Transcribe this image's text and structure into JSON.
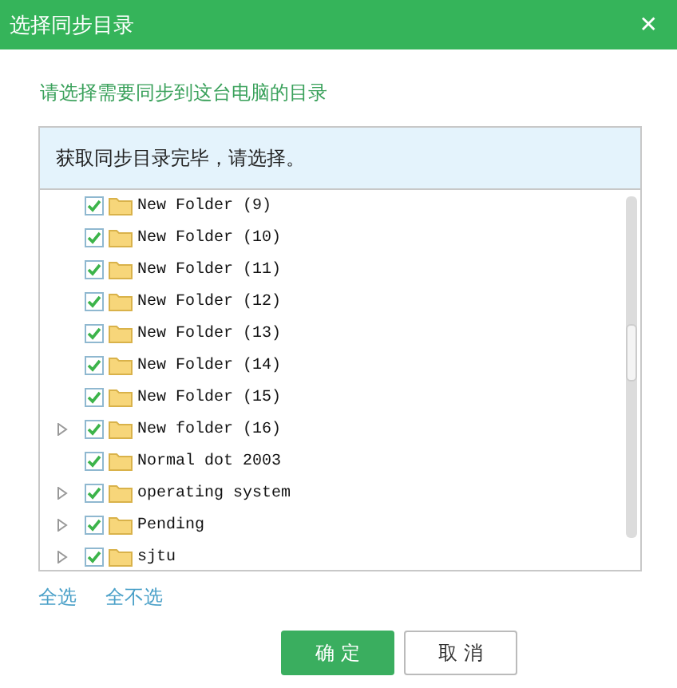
{
  "window": {
    "title": "选择同步目录",
    "close": "✕"
  },
  "instruction": "请选择需要同步到这台电脑的目录",
  "status": "获取同步目录完毕，请选择。",
  "tree": [
    {
      "label": "New Folder (9)",
      "checked": true,
      "expandable": false
    },
    {
      "label": "New Folder (10)",
      "checked": true,
      "expandable": false
    },
    {
      "label": "New Folder (11)",
      "checked": true,
      "expandable": false
    },
    {
      "label": "New Folder (12)",
      "checked": true,
      "expandable": false
    },
    {
      "label": "New Folder (13)",
      "checked": true,
      "expandable": false
    },
    {
      "label": "New Folder (14)",
      "checked": true,
      "expandable": false
    },
    {
      "label": "New Folder (15)",
      "checked": true,
      "expandable": false
    },
    {
      "label": "New folder (16)",
      "checked": true,
      "expandable": true
    },
    {
      "label": "Normal dot 2003",
      "checked": true,
      "expandable": false
    },
    {
      "label": "operating system",
      "checked": true,
      "expandable": true
    },
    {
      "label": "Pending",
      "checked": true,
      "expandable": true
    },
    {
      "label": "sjtu",
      "checked": true,
      "expandable": true
    }
  ],
  "links": [
    "全选",
    "全不选"
  ],
  "buttons": [
    {
      "label": "确 定",
      "kind": "primary"
    },
    {
      "label": "取 消",
      "kind": "secondary"
    }
  ]
}
